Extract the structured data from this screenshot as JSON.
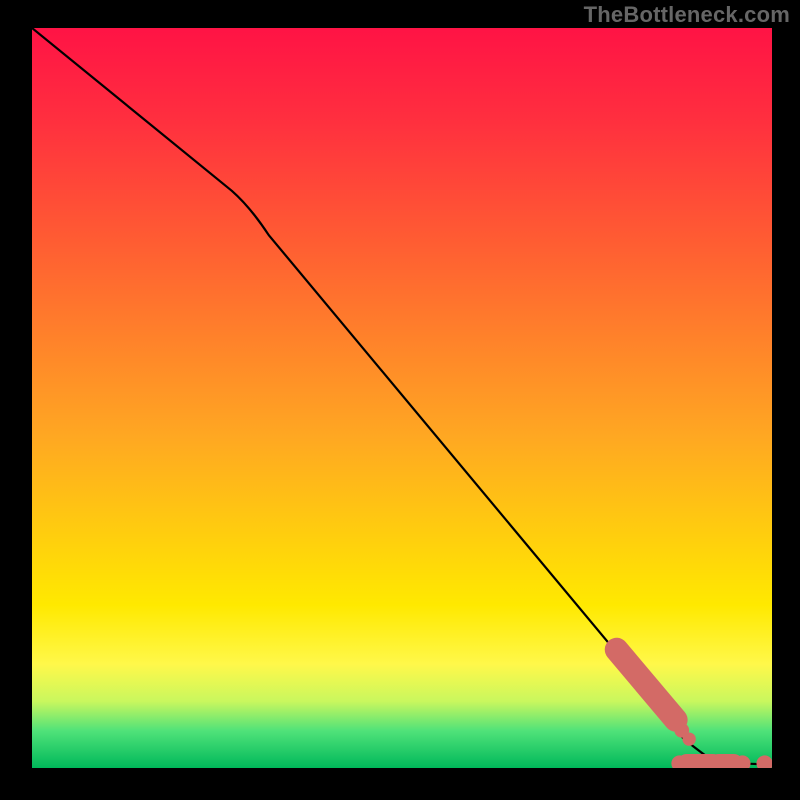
{
  "watermark": "TheBottleneck.com",
  "chart_data": {
    "type": "line",
    "title": "",
    "xlabel": "",
    "ylabel": "",
    "xlim": [
      0,
      100
    ],
    "ylim": [
      0,
      100
    ],
    "curve": [
      {
        "x": 0,
        "y": 100
      },
      {
        "x": 27,
        "y": 78
      },
      {
        "x": 32,
        "y": 72
      },
      {
        "x": 82,
        "y": 12
      },
      {
        "x": 88,
        "y": 4
      },
      {
        "x": 92,
        "y": 1
      },
      {
        "x": 100,
        "y": 0.5
      }
    ],
    "marker_color": "#d36a66",
    "markers_diag_segment": {
      "x0": 79,
      "y0": 16,
      "x1": 87,
      "y1": 6.5,
      "width": 3.2
    },
    "markers_bottom": [
      {
        "x": 87.5,
        "r": 1.1
      },
      {
        "x": 89.0,
        "r": 1.0
      },
      {
        "x": 90.2,
        "r": 1.0
      },
      {
        "x": 91.3,
        "r": 1.0
      },
      {
        "x": 93.0,
        "r": 1.0
      },
      {
        "x": 94.2,
        "r": 1.0
      },
      {
        "x": 96.0,
        "r": 1.1
      },
      {
        "x": 99.0,
        "r": 1.1
      }
    ],
    "markers_bottom_segments": [
      {
        "x0": 88.5,
        "x1": 92.0,
        "width": 2.6
      },
      {
        "x0": 92.8,
        "x1": 94.8,
        "width": 2.6
      }
    ]
  }
}
